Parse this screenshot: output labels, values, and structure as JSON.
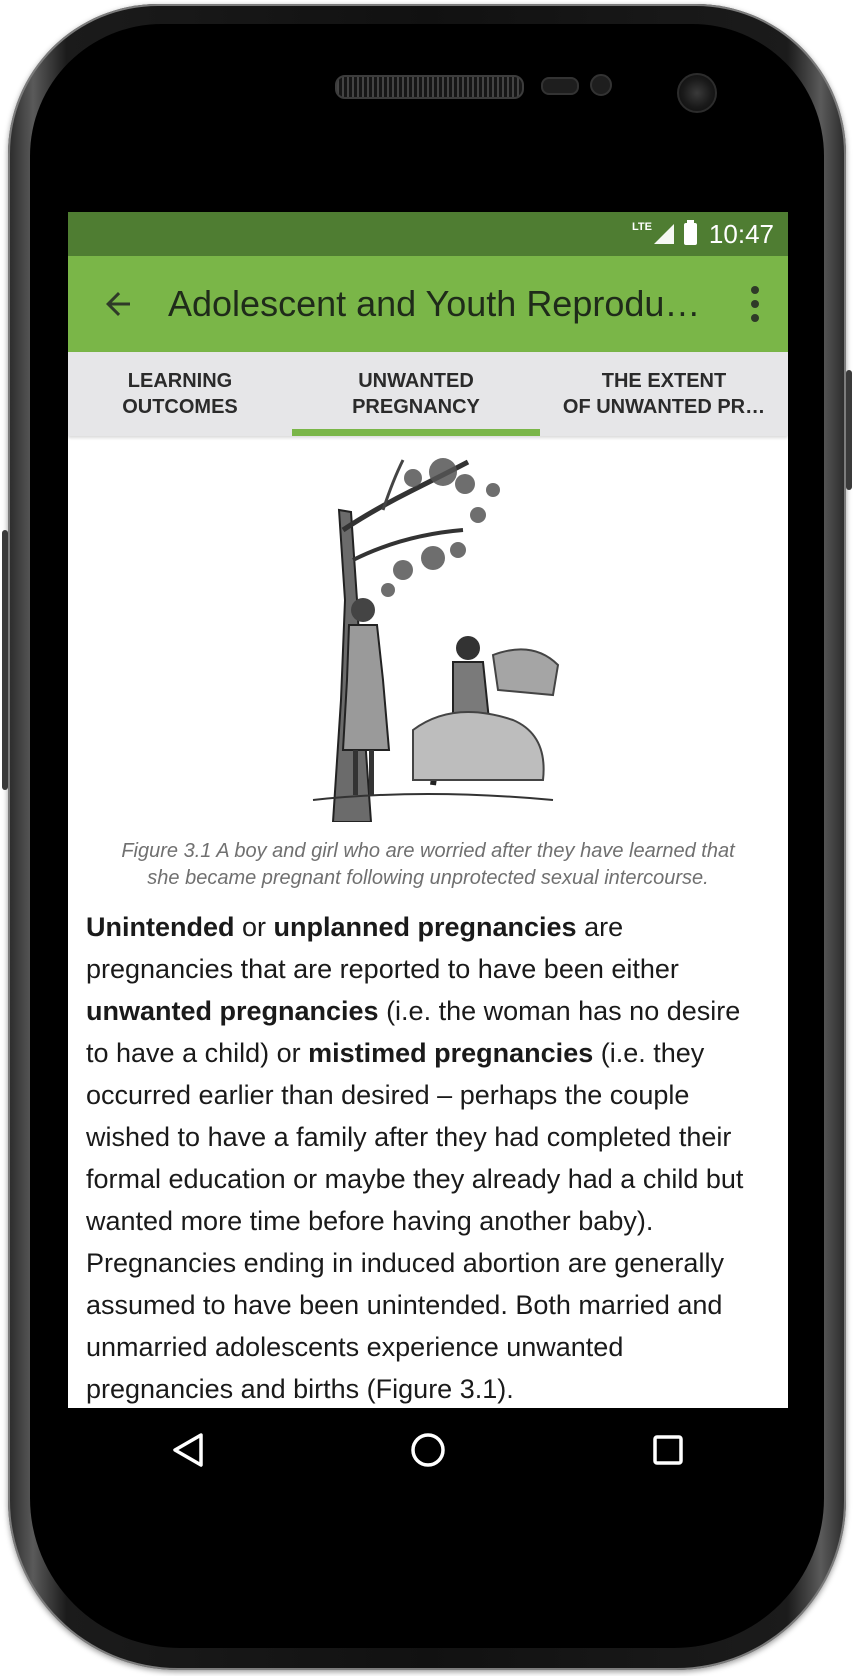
{
  "status_bar": {
    "network": "LTE",
    "time": "10:47"
  },
  "app_bar": {
    "title": "Adolescent and Youth Reproduc…"
  },
  "tabs": [
    {
      "label": "LEARNING\nOUTCOMES"
    },
    {
      "label": "UNWANTED\nPREGNANCY"
    },
    {
      "label": "THE EXTENT\nOF UNWANTED PR…"
    }
  ],
  "figure": {
    "caption_line1": "Figure 3.1 A boy and girl who are worried after they have learned that",
    "caption_line2": "she became pregnant following unprotected sexual intercourse."
  },
  "paragraph": {
    "s1": "Unintended",
    "s2": " or ",
    "s3": "unplanned pregnancies",
    "s4": " are pregnancies that are reported to have been either ",
    "s5": "unwanted pregnancies",
    "s6": " (i.e. the woman has no desire to have a child) or ",
    "s7": "mistimed pregnancies",
    "s8": " (i.e. they occurred earlier than desired – perhaps the couple wished to have a family after they had completed their formal education or maybe they already had a child but wanted more time before having another baby). Pregnancies ending in induced abortion are generally assumed to have been unintended. Both married and unmarried adolescents experience unwanted pregnancies and births (Figure 3.1)."
  },
  "colors": {
    "status_bar": "#4f7d32",
    "app_bar": "#7ab648",
    "tab_indicator": "#7ab648",
    "tab_bg": "#e6e6e8"
  }
}
